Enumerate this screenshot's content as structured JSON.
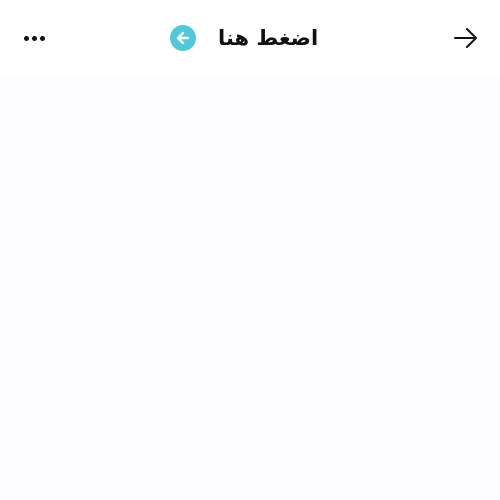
{
  "header": {
    "title": "اضغط هنا",
    "title_icon": "arrow-left-circle-icon",
    "more_icon": "more-horizontal-icon",
    "forward_icon": "arrow-right-icon",
    "accent_color": "#4fc9d9"
  }
}
